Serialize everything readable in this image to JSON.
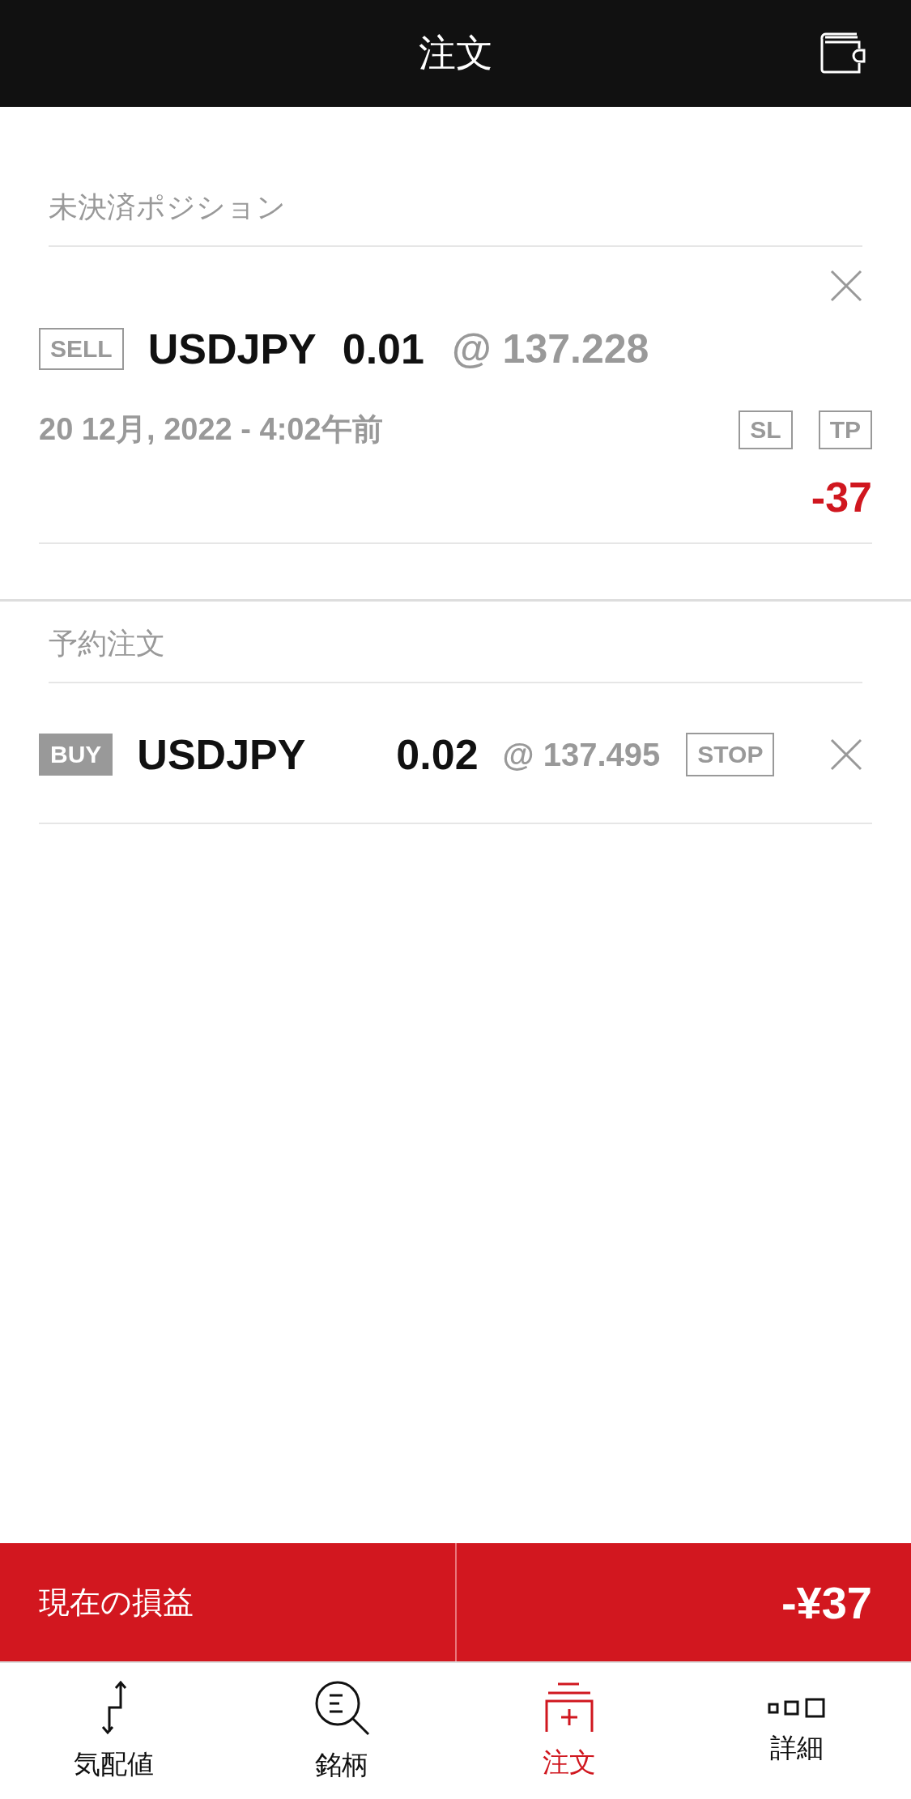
{
  "header": {
    "title": "注文"
  },
  "open_positions": {
    "title": "未決済ポジション",
    "items": [
      {
        "side": "SELL",
        "side_filled": false,
        "symbol": "USDJPY",
        "volume": "0.01",
        "price": "@ 137.228",
        "time": "20 12月, 2022 - 4:02午前",
        "tags": [
          "SL",
          "TP"
        ],
        "profit": "-37"
      }
    ]
  },
  "pending_orders": {
    "title": "予約注文",
    "items": [
      {
        "side": "BUY",
        "side_filled": true,
        "symbol": "USDJPY",
        "volume": "0.02",
        "price": "@ 137.495",
        "type": "STOP"
      }
    ]
  },
  "pnl_bar": {
    "label": "現在の損益",
    "value": "-¥37"
  },
  "tabs": [
    {
      "kind": "quotes",
      "label": "気配値",
      "selected": false
    },
    {
      "kind": "symbols",
      "label": "銘柄",
      "selected": false
    },
    {
      "kind": "orders",
      "label": "注文",
      "selected": true
    },
    {
      "kind": "details",
      "label": "詳細",
      "selected": false
    }
  ]
}
